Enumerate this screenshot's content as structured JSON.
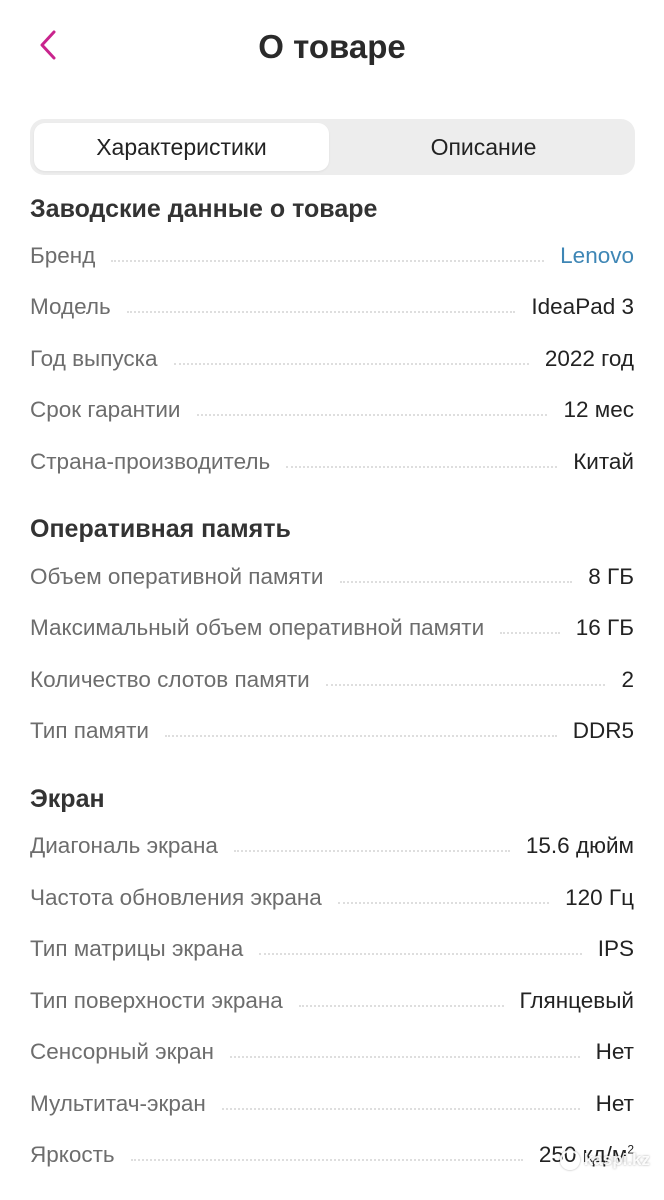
{
  "header": {
    "title": "О товаре",
    "back_icon": "chevron-left-icon",
    "accent_color": "#c9248d"
  },
  "tabs": [
    {
      "label": "Характеристики",
      "active": true
    },
    {
      "label": "Описание",
      "active": false
    }
  ],
  "sections": [
    {
      "title": "Заводские данные о товаре",
      "rows": [
        {
          "label": "Бренд",
          "value": "Lenovo",
          "link": true
        },
        {
          "label": "Модель",
          "value": "IdeaPad 3"
        },
        {
          "label": "Год выпуска",
          "value": "2022 год"
        },
        {
          "label": "Срок гарантии",
          "value": "12 мес"
        },
        {
          "label": "Страна-производитель",
          "value": "Китай"
        }
      ]
    },
    {
      "title": "Оперативная память",
      "rows": [
        {
          "label": "Объем оперативной памяти",
          "value": "8 ГБ"
        },
        {
          "label": "Максимальный объем оперативной памяти",
          "value": "16 ГБ"
        },
        {
          "label": "Количество слотов памяти",
          "value": "2"
        },
        {
          "label": "Тип памяти",
          "value": "DDR5"
        }
      ]
    },
    {
      "title": "Экран",
      "rows": [
        {
          "label": "Диагональ экрана",
          "value": "15.6 дюйм"
        },
        {
          "label": "Частота обновления экрана",
          "value": "120 Гц"
        },
        {
          "label": "Тип матрицы экрана",
          "value": "IPS"
        },
        {
          "label": "Тип поверхности экрана",
          "value": "Глянцевый"
        },
        {
          "label": "Сенсорный экран",
          "value": "Нет"
        },
        {
          "label": "Мультитач-экран",
          "value": "Нет"
        },
        {
          "label": "Яркость",
          "value": "250 кд/м",
          "value_sup": "2"
        }
      ]
    }
  ],
  "watermark": {
    "text": "kaspi.kz"
  }
}
